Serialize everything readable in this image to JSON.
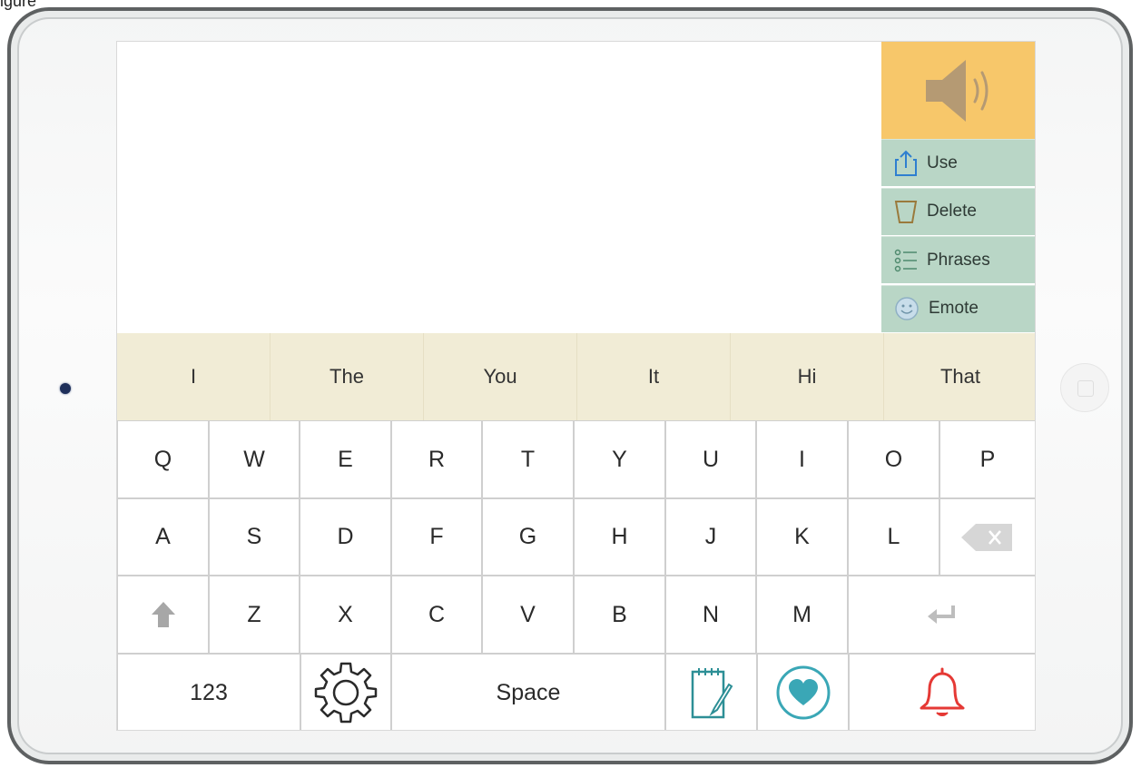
{
  "caption_fragment": "igure",
  "output": {
    "text": ""
  },
  "speak": {
    "icon": "speaker-icon",
    "color": "#f7c76a"
  },
  "side_menu": [
    {
      "label": "Use",
      "icon": "share-icon"
    },
    {
      "label": "Delete",
      "icon": "trash-icon"
    },
    {
      "label": "Phrases",
      "icon": "list-icon"
    },
    {
      "label": "Emote",
      "icon": "smiley-icon"
    }
  ],
  "predictions": [
    "I",
    "The",
    "You",
    "It",
    "Hi",
    "That"
  ],
  "keyboard": {
    "row1": [
      "Q",
      "W",
      "E",
      "R",
      "T",
      "Y",
      "U",
      "I",
      "O",
      "P"
    ],
    "row2": [
      "A",
      "S",
      "D",
      "F",
      "G",
      "H",
      "J",
      "K",
      "L"
    ],
    "row3": [
      "Z",
      "X",
      "C",
      "V",
      "B",
      "N",
      "M"
    ],
    "numbers_label": "123",
    "space_label": "Space",
    "special_icons": {
      "backspace": "backspace-icon",
      "shift": "shift-arrow-icon",
      "return": "return-icon",
      "settings": "gear-icon",
      "notepad": "notepad-icon",
      "favorites": "heart-icon",
      "alert": "bell-icon"
    }
  },
  "colors": {
    "speak_bg": "#f7c76a",
    "menu_bg": "#b9d6c6",
    "prediction_bg": "#f1ecd6",
    "bell": "#e53935",
    "accent_teal": "#3aa7b6"
  }
}
